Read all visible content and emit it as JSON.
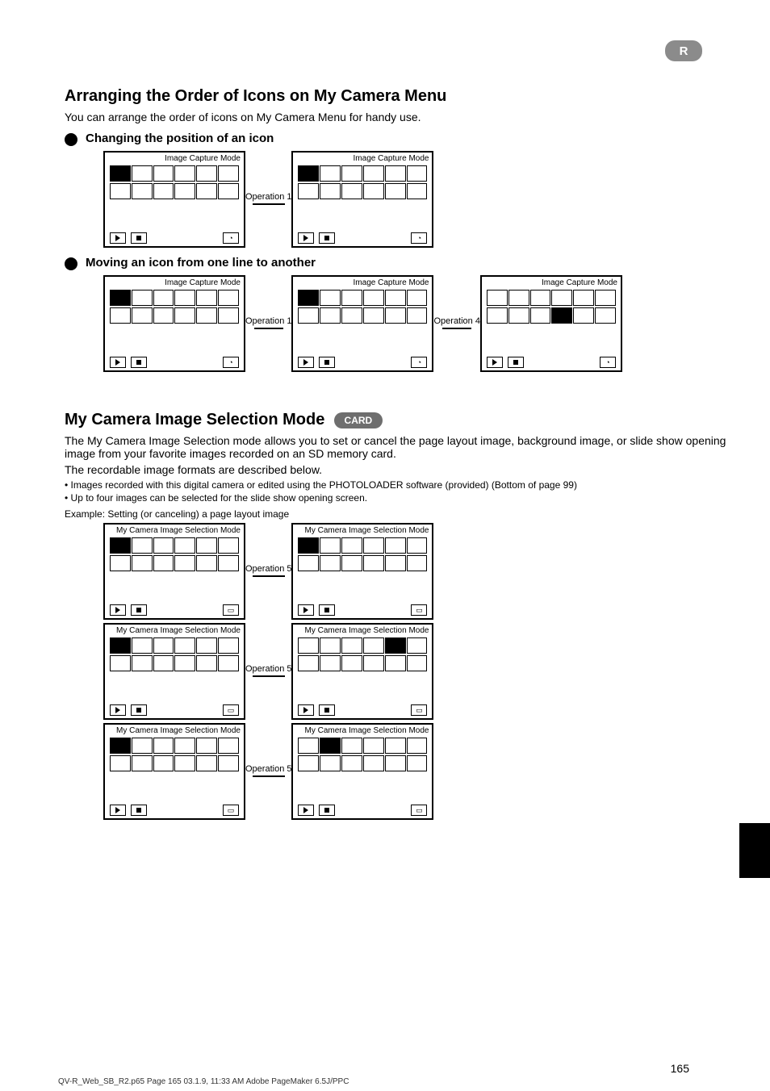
{
  "badge_r": "R",
  "side_tab": "",
  "section1": {
    "title": "Arranging the Order of Icons on My Camera Menu",
    "lead": "You can arrange the order of icons on My Camera Menu for handy use.",
    "bullet1": {
      "text": "Changing the position of an icon",
      "op": "Operation 1",
      "screen": {
        "label": "Image Capture Mode",
        "footer_mode": "clock"
      }
    },
    "bullet2": {
      "text": "Moving an icon from one line to another",
      "op1": "Operation 1",
      "op2": "Operation 4",
      "screen": {
        "label": "Image Capture Mode",
        "footer_mode": "clock"
      }
    }
  },
  "section2": {
    "title": "My Camera Image Selection Mode",
    "card_badge": "CARD",
    "para1": "The My Camera Image Selection mode allows you to set or cancel the page layout image, background image, or slide show opening image from your favorite images recorded on an SD memory card.",
    "para2": "The recordable image formats are described below.",
    "note1": "• Images recorded with this digital camera or edited using the PHOTOLOADER software (provided) (Bottom of page 99)",
    "note2": "• Up to four images can be selected for the slide show opening screen.",
    "example_label": "Example: Setting (or canceling) a page layout image",
    "rows": [
      {
        "op": "Operation 5",
        "left_label": "My Camera Image Selection Mode",
        "right_label": "My Camera Image Selection Mode",
        "footer_mode": "page"
      },
      {
        "op": "Operation 5",
        "left_label": "My Camera Image Selection Mode",
        "right_label": "My Camera Image Selection Mode",
        "footer_mode": "page"
      },
      {
        "op": "Operation 5",
        "left_label": "My Camera Image Selection Mode",
        "right_label": "My Camera Image Selection Mode",
        "footer_mode": "page"
      }
    ]
  },
  "page_number": "165",
  "footer_line": "QV-R_Web_SB_R2.p65                     Page 165                    03.1.9, 11:33 AM                    Adobe PageMaker 6.5J/PPC"
}
